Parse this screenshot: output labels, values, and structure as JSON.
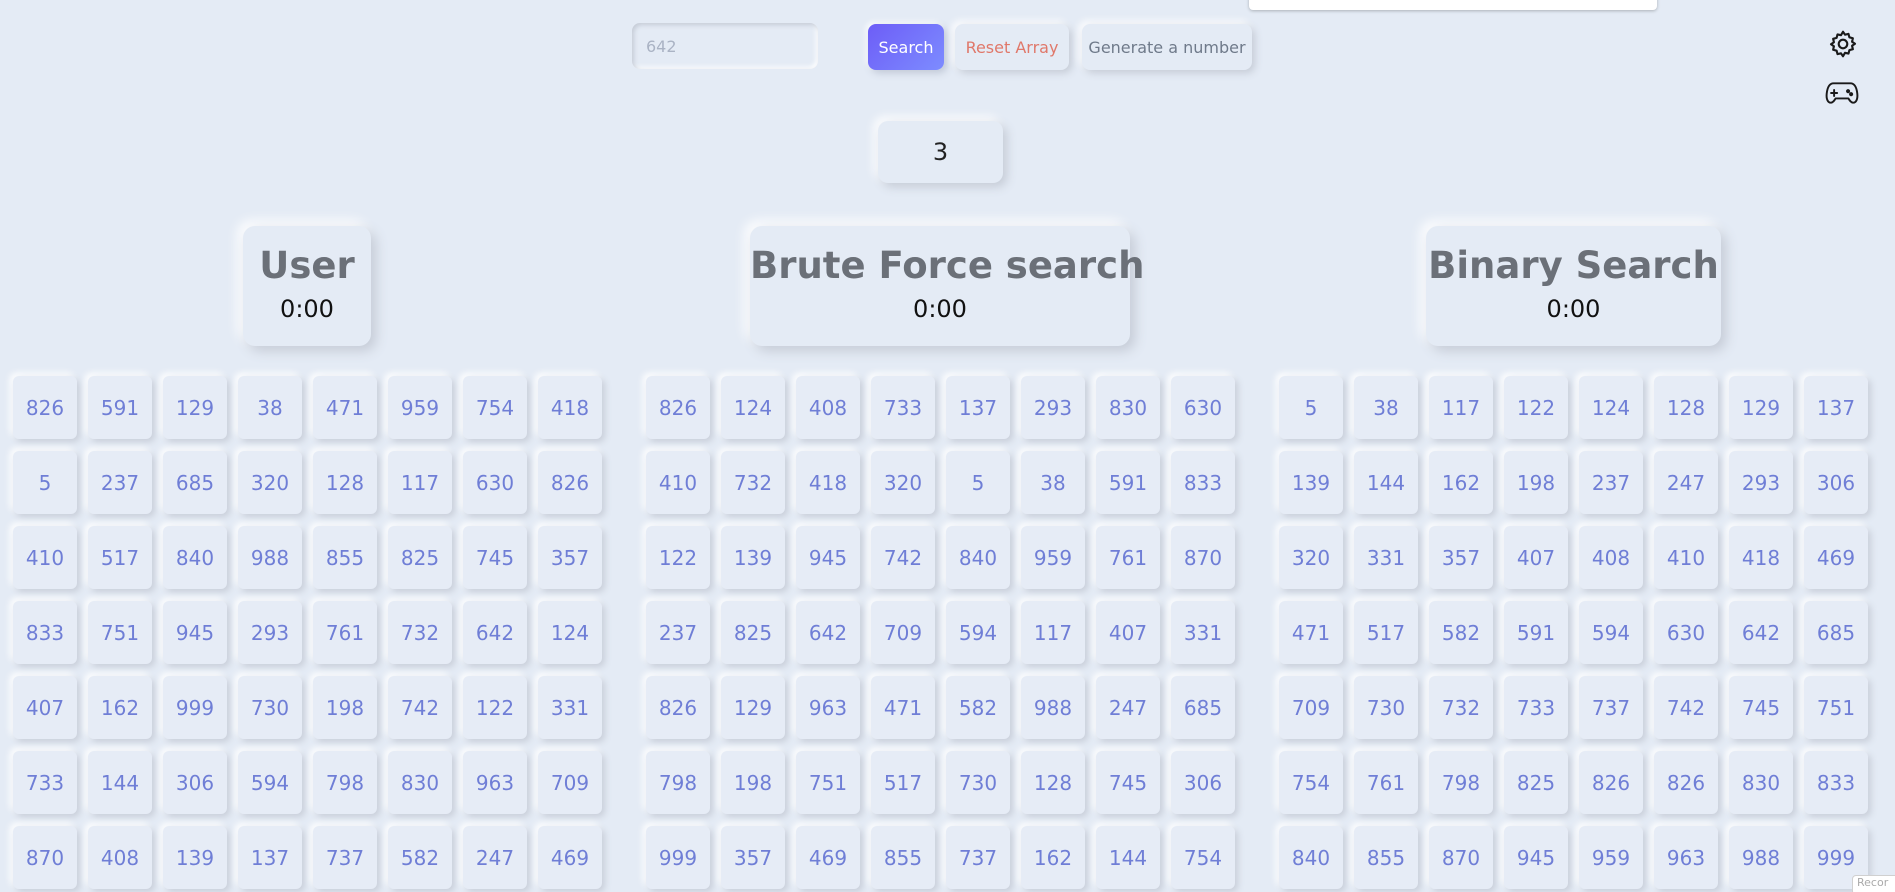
{
  "toolbar": {
    "search_placeholder": "642",
    "search_label": "Search",
    "reset_label": "Reset Array",
    "generate_label": "Generate a number"
  },
  "icons": {
    "settings": "settings-gear-icon",
    "game": "gamepad-icon"
  },
  "result": "3",
  "panels": [
    {
      "title": "User",
      "timer": "0:00",
      "cells": [
        "826",
        "591",
        "129",
        "38",
        "471",
        "959",
        "754",
        "418",
        "5",
        "237",
        "685",
        "320",
        "128",
        "117",
        "630",
        "826",
        "410",
        "517",
        "840",
        "988",
        "855",
        "825",
        "745",
        "357",
        "833",
        "751",
        "945",
        "293",
        "761",
        "732",
        "642",
        "124",
        "407",
        "162",
        "999",
        "730",
        "198",
        "742",
        "122",
        "331",
        "733",
        "144",
        "306",
        "594",
        "798",
        "830",
        "963",
        "709",
        "870",
        "408",
        "139",
        "137",
        "737",
        "582",
        "247",
        "469"
      ]
    },
    {
      "title": "Brute Force search",
      "timer": "0:00",
      "cells": [
        "826",
        "124",
        "408",
        "733",
        "137",
        "293",
        "830",
        "630",
        "410",
        "732",
        "418",
        "320",
        "5",
        "38",
        "591",
        "833",
        "122",
        "139",
        "945",
        "742",
        "840",
        "959",
        "761",
        "870",
        "237",
        "825",
        "642",
        "709",
        "594",
        "117",
        "407",
        "331",
        "826",
        "129",
        "963",
        "471",
        "582",
        "988",
        "247",
        "685",
        "798",
        "198",
        "751",
        "517",
        "730",
        "128",
        "745",
        "306",
        "999",
        "357",
        "469",
        "855",
        "737",
        "162",
        "144",
        "754"
      ]
    },
    {
      "title": "Binary Search",
      "timer": "0:00",
      "cells": [
        "5",
        "38",
        "117",
        "122",
        "124",
        "128",
        "129",
        "137",
        "139",
        "144",
        "162",
        "198",
        "237",
        "247",
        "293",
        "306",
        "320",
        "331",
        "357",
        "407",
        "408",
        "410",
        "418",
        "469",
        "471",
        "517",
        "582",
        "591",
        "594",
        "630",
        "642",
        "685",
        "709",
        "730",
        "732",
        "733",
        "737",
        "742",
        "745",
        "751",
        "754",
        "761",
        "798",
        "825",
        "826",
        "826",
        "830",
        "833",
        "840",
        "855",
        "870",
        "945",
        "959",
        "963",
        "988",
        "999"
      ]
    }
  ],
  "corner_tag": "Recor"
}
